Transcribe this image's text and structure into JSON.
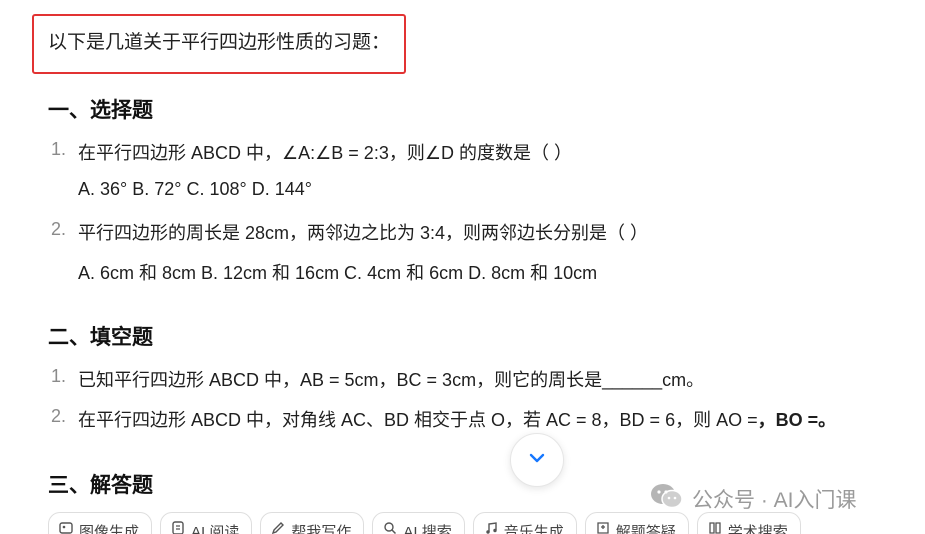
{
  "intro": {
    "text": "以下是几道关于平行四边形性质的习题："
  },
  "sections": {
    "choice": {
      "heading": "一、选择题",
      "q1": {
        "num": "1.",
        "text": "在平行四边形 ABCD 中，∠A:∠B = 2:3，则∠D 的度数是（ ）",
        "options": "A. 36° B. 72° C. 108° D. 144°"
      },
      "q2": {
        "num": "2.",
        "text": "平行四边形的周长是 28cm，两邻边之比为 3:4，则两邻边长分别是（ ）",
        "options": "A. 6cm 和 8cm B. 12cm 和 16cm C. 4cm 和 6cm D. 8cm 和 10cm"
      }
    },
    "fill": {
      "heading": "二、填空题",
      "q1": {
        "num": "1.",
        "text": "已知平行四边形 ABCD 中，AB = 5cm，BC = 3cm，则它的周长是______cm。"
      },
      "q2": {
        "num": "2.",
        "text": "在平行四边形 ABCD 中，对角线 AC、BD 相交于点 O，若 AC = 8，BD = 6，则 AO =",
        "tail": "，BO =。"
      }
    },
    "answer": {
      "heading": "三、解答题"
    }
  },
  "scroll_button": {
    "icon": "chevron-down-icon"
  },
  "watermark": {
    "text": "公众号 · AI入门课",
    "icon": "wechat-icon"
  },
  "toolbar": {
    "items": [
      {
        "label": "图像生成",
        "icon": "image-gen-icon"
      },
      {
        "label": "AI 阅读",
        "icon": "ai-read-icon"
      },
      {
        "label": "帮我写作",
        "icon": "pen-icon"
      },
      {
        "label": "AI 搜索",
        "icon": "ai-search-icon"
      },
      {
        "label": "音乐生成",
        "icon": "music-icon"
      },
      {
        "label": "解题答疑",
        "icon": "solve-icon"
      },
      {
        "label": "学术搜索",
        "icon": "book-icon"
      }
    ]
  },
  "colors": {
    "highlight_border": "#e23333",
    "accent": "#1677ff",
    "muted": "#8a8a8a"
  }
}
